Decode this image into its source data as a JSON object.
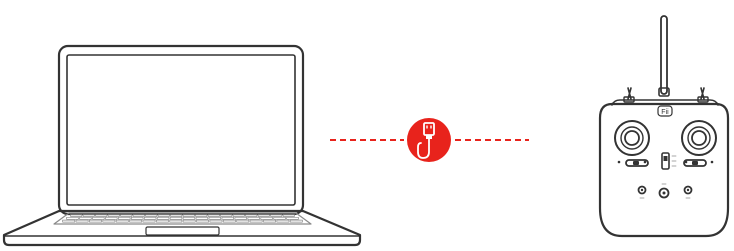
{
  "diagram": {
    "nodes": [
      {
        "id": "laptop",
        "icon": "laptop-icon"
      },
      {
        "id": "usb-link",
        "icon": "usb-cable-icon"
      },
      {
        "id": "remote-controller",
        "icon": "remote-controller-icon",
        "label": "Fii"
      }
    ],
    "connection": {
      "style": "dashed",
      "from": "laptop",
      "to": "remote-controller",
      "via": "usb-link"
    }
  },
  "colors": {
    "outline": "#333333",
    "outline_light": "#8a8a8a",
    "accent": "#e8231c",
    "background": "#ffffff"
  }
}
